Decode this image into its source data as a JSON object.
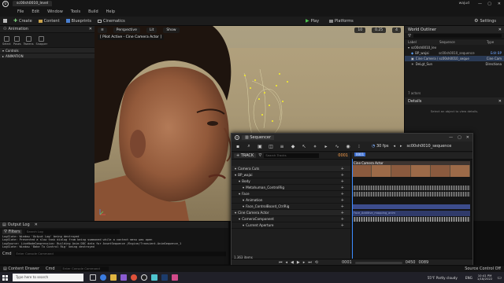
{
  "window": {
    "doc_tab": "sc00sh0010_level",
    "controls": [
      "—",
      "▢",
      "✕"
    ],
    "user": "wajud"
  },
  "menu": [
    "File",
    "Edit",
    "Window",
    "Tools",
    "Build",
    "Help"
  ],
  "toolbar": {
    "save": "Create",
    "content": "Content",
    "blueprints": "Blueprints",
    "cinematics": "Cinematics",
    "play": "Play",
    "platforms": "Platforms",
    "settings": "Settings"
  },
  "left_panel": {
    "title": "Animation",
    "modes": [
      "Select",
      "Poses",
      "Tweens",
      "Snapper"
    ],
    "sections": [
      "Controls",
      "ANIMATION"
    ]
  },
  "viewport": {
    "perspective": "Perspective",
    "lit": "Lit",
    "show": "Show",
    "pilot_label": "[ Pilot Active - Cine Camera Actor ]",
    "fov": "10",
    "scale": "0.25",
    "speed": "4"
  },
  "outliner": {
    "title": "World Outliner",
    "columns": {
      "label": "Label",
      "type": "Type",
      "sequence": "Sequence"
    },
    "items": [
      {
        "label": "sc00sh0010_lev",
        "seq": "",
        "type": ""
      },
      {
        "label": "BP_wajai",
        "seq": "sc00sh0010_sequence",
        "type": "Edit BP"
      },
      {
        "label": "Cine Camera / sc00sh0010_seque",
        "seq": "",
        "type": "Cine Cam"
      },
      {
        "label": "DeLgt_Sun",
        "seq": "",
        "type": "Directiona"
      }
    ],
    "actors_count": "7 actors",
    "details_title": "Details",
    "details_hint": "Select an object to view details."
  },
  "output_log": {
    "title": "Output Log",
    "filters": "Filters",
    "search_placeholder": "Search Log",
    "lines": [
      "LogSlate: Window 'Output Log' being destroyed",
      "LogSlate: Prevented a slow task dialog from being summoned while a context menu was open",
      "LogSource: LiveNodeCompression: Building Anim DDC data for AssetSequence /Engine/Transient.AnimSequence_1",
      "LogSlate: Window 'Bake To Control Rig' being destroyed"
    ],
    "cmd": "Cmd",
    "cmd_placeholder": "Enter Console Command"
  },
  "sequencer": {
    "title": "Sequencer",
    "fps": "30 fps",
    "breadcrumb": "sc00sh0010_sequence",
    "track_label": "+ TRACK",
    "search_placeholder": "Search Tracks",
    "frame": "0001",
    "playhead": "0001",
    "tracks": [
      {
        "label": "Camera Cuts",
        "indent": 0
      },
      {
        "label": "BP_wajai",
        "indent": 0
      },
      {
        "label": "Body",
        "indent": 1
      },
      {
        "label": "Metahuman_ControlRig",
        "indent": 2
      },
      {
        "label": "Face",
        "indent": 1
      },
      {
        "label": "Animation",
        "indent": 2
      },
      {
        "label": "Face_ControlBoard_CtrlRig",
        "indent": 2
      },
      {
        "label": "Cine Camera Actor",
        "indent": 0
      },
      {
        "label": "CameraComponent",
        "indent": 1
      },
      {
        "label": "Current Aperture",
        "indent": 2
      }
    ],
    "cam_clip": "Cine Camera Actor",
    "face_clip": "Face_Additive_mapping_anim",
    "items_count": "1,363 items",
    "aperture_value": "2.8",
    "timeline": [
      "0001",
      "0450",
      "0089"
    ]
  },
  "statusbar": {
    "content_drawer": "Content Drawer",
    "cmd": "Cmd",
    "cmd_placeholder": "Enter Console Command",
    "source_control": "Source Control Off"
  },
  "taskbar": {
    "search_placeholder": "Type here to search",
    "weather": "55°F  Partly cloudy",
    "lang": "ENG",
    "time": "10:41 PM",
    "date": "1/18/2022"
  }
}
